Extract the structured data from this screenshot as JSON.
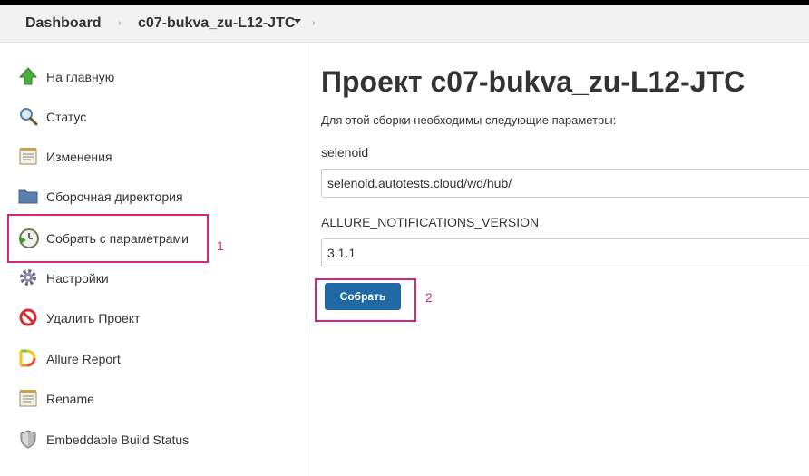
{
  "breadcrumb": {
    "dashboard": "Dashboard",
    "separator": "›",
    "project": "c07-bukva_zu-L12-JTC",
    "separator2": "›"
  },
  "sidebar": {
    "items": [
      {
        "label": "На главную",
        "icon": "up-arrow-icon"
      },
      {
        "label": "Статус",
        "icon": "magnifier-icon"
      },
      {
        "label": "Изменения",
        "icon": "notepad-icon"
      },
      {
        "label": "Сборочная директория",
        "icon": "folder-icon"
      },
      {
        "label": "Собрать с параметрами",
        "icon": "clock-play-icon"
      },
      {
        "label": "Настройки",
        "icon": "gear-icon"
      },
      {
        "label": "Удалить Проект",
        "icon": "no-entry-icon"
      },
      {
        "label": "Allure Report",
        "icon": "allure-icon"
      },
      {
        "label": "Rename",
        "icon": "notepad-icon"
      },
      {
        "label": "Embeddable Build Status",
        "icon": "shield-icon"
      }
    ]
  },
  "main": {
    "title": "Проект c07-bukva_zu-L12-JTC",
    "description": "Для этой сборки необходимы следующие параметры:",
    "params": [
      {
        "name": "selenoid",
        "value": "selenoid.autotests.cloud/wd/hub/"
      },
      {
        "name": "ALLURE_NOTIFICATIONS_VERSION",
        "value": "3.1.1"
      }
    ],
    "build_button": "Собрать"
  },
  "annotations": {
    "first": "1",
    "second": "2"
  },
  "colors": {
    "highlight": "#d6267a",
    "button": "#1f6aa5"
  }
}
